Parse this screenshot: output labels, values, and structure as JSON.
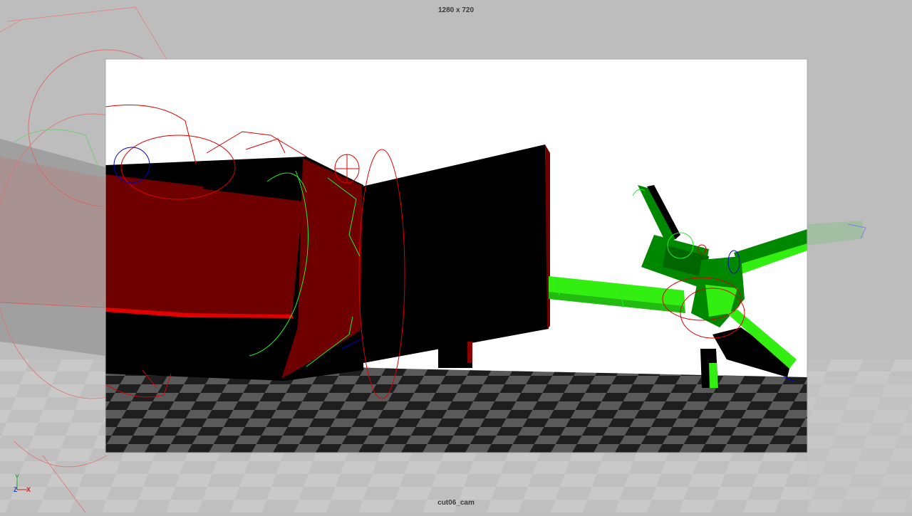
{
  "viewport": {
    "resolution_label": "1280 x 720",
    "camera_name": "cut06_cam"
  },
  "axis_gizmo": {
    "y_label": "Y",
    "z_label": "Z",
    "x_label": "X"
  },
  "colors": {
    "outer_background": "#bdbdbd",
    "gate_background": "#ffffff",
    "floor_dark": "#1e1e1e",
    "floor_light": "#5a5a5a",
    "robot_red": "#6e0000",
    "bright_red": "#e00000",
    "robot_black": "#000000",
    "character_green": "#008800",
    "bright_green": "#33ee11",
    "control_red": "#dd0000",
    "control_green": "#22ee22",
    "control_blue": "#0000cc"
  }
}
